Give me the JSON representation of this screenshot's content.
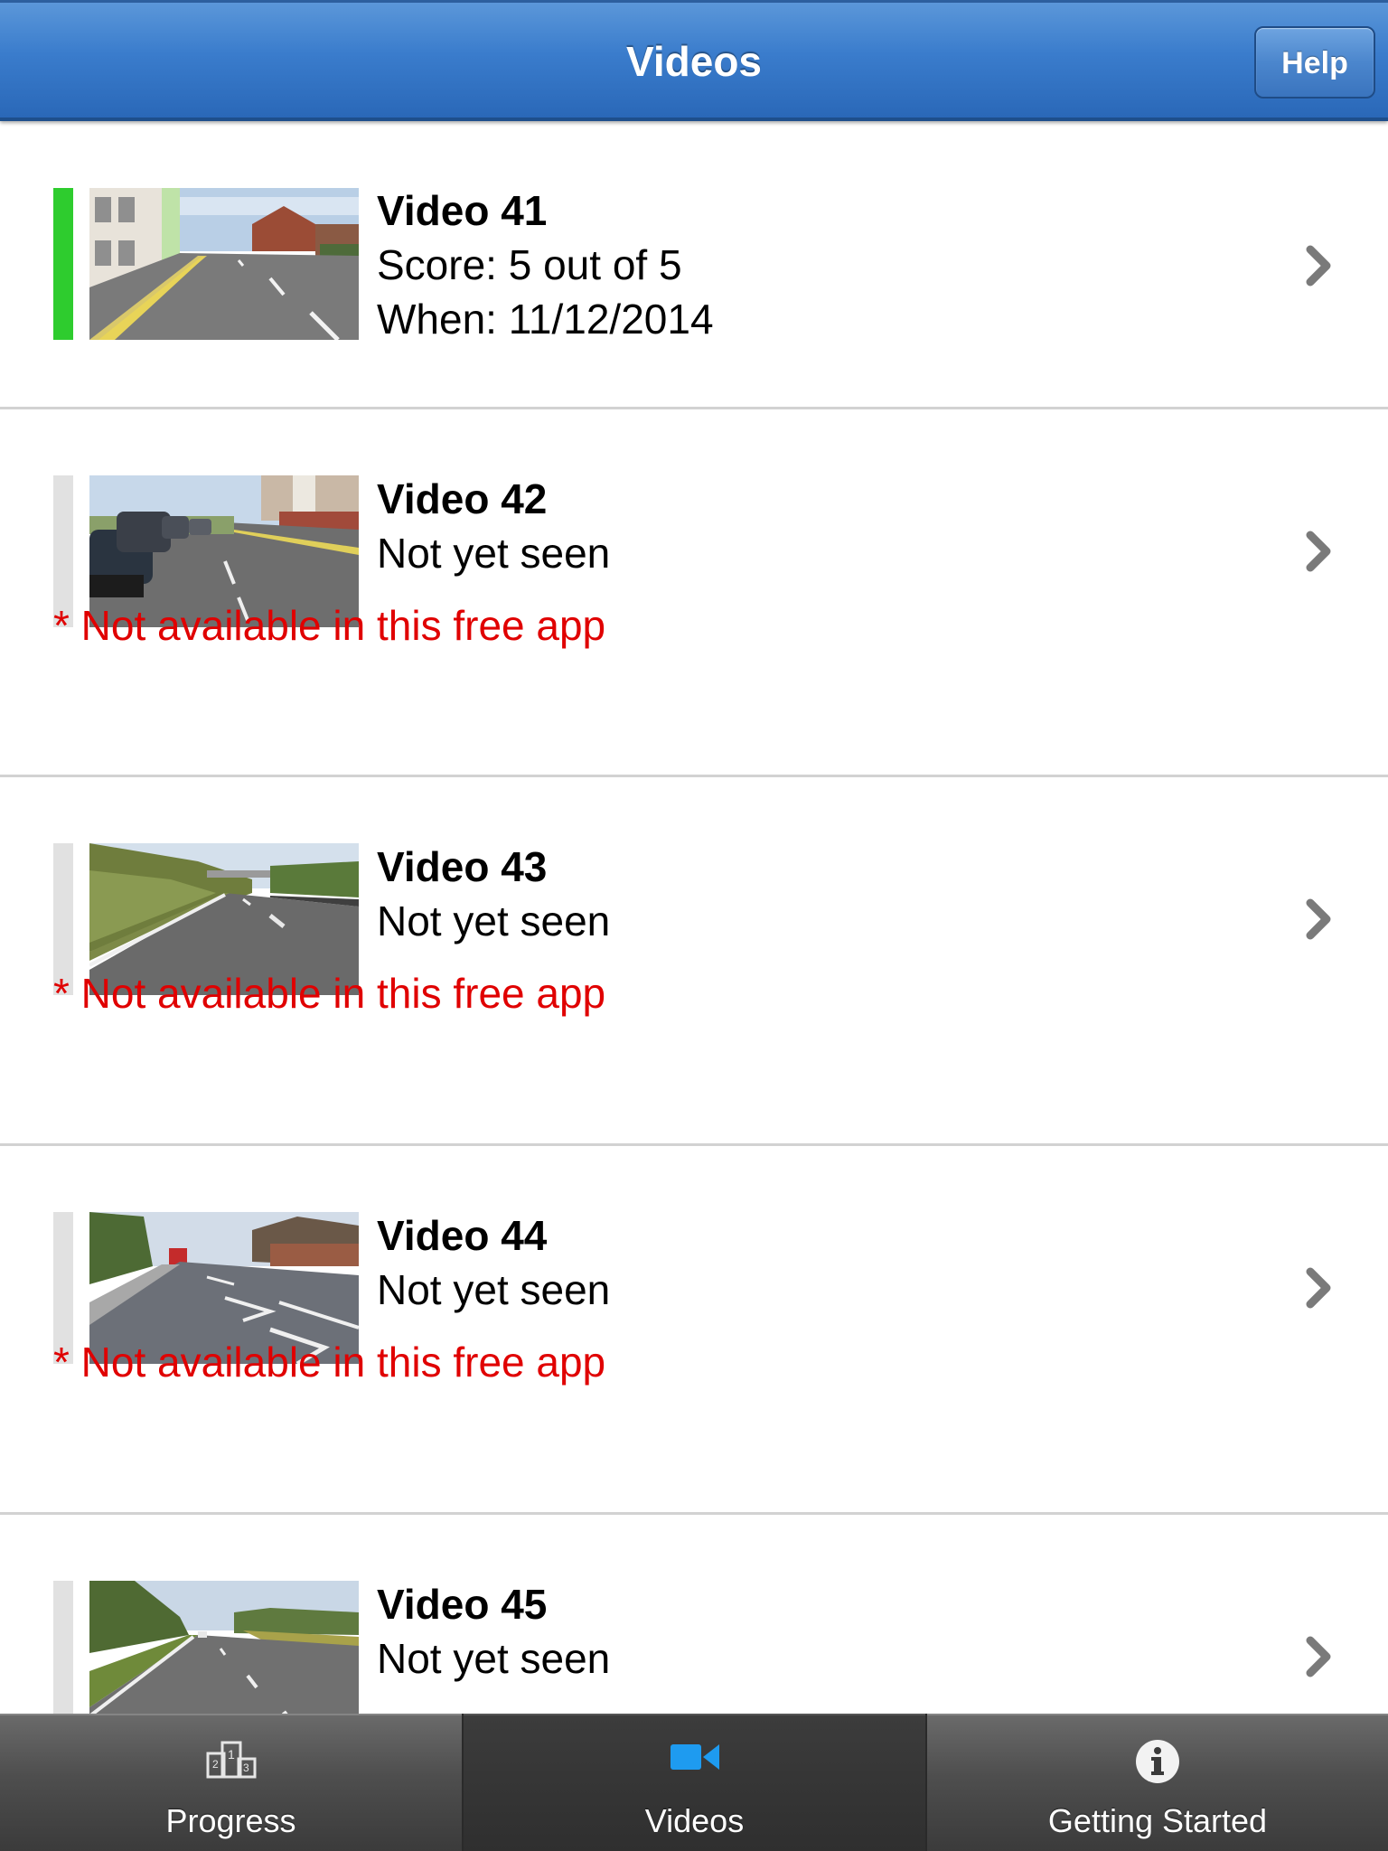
{
  "header": {
    "title": "Videos",
    "help_label": "Help"
  },
  "videos": [
    {
      "title": "Video 41",
      "score_line": "Score:  5 out of 5",
      "when_line": "When:  11/12/2014",
      "status": "complete",
      "notice": ""
    },
    {
      "title": "Video 42",
      "status_line": "Not yet seen",
      "status": "unseen",
      "notice": "* Not available in this free app"
    },
    {
      "title": "Video 43",
      "status_line": "Not yet seen",
      "status": "unseen",
      "notice": "* Not available in this free app"
    },
    {
      "title": "Video 44",
      "status_line": "Not yet seen",
      "status": "unseen",
      "notice": "* Not available in this free app"
    },
    {
      "title": "Video 45",
      "status_line": "Not yet seen",
      "status": "unseen",
      "notice": ""
    }
  ],
  "icons": {
    "row_disclosure": "chevron-right-icon",
    "progress_tab": "podium-icon",
    "videos_tab": "video-camera-icon",
    "getting_started_tab": "info-icon"
  },
  "colors": {
    "header_blue": "#3a7ccc",
    "complete_green": "#2ecc2e",
    "unseen_grey": "#e1e1e1",
    "notice_red": "#e00000",
    "active_tab_icon": "#1e9bf0"
  },
  "tabbar": {
    "tabs": [
      {
        "label": "Progress",
        "active": false
      },
      {
        "label": "Videos",
        "active": true
      },
      {
        "label": "Getting Started",
        "active": false
      }
    ]
  }
}
